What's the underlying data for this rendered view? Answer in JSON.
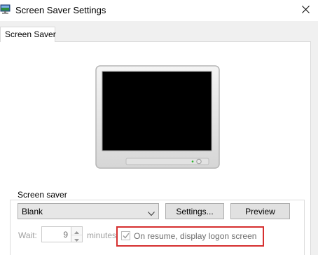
{
  "window": {
    "title": "Screen Saver Settings",
    "app_icon": "monitor-icon",
    "close_icon": "close-icon"
  },
  "tabs": [
    {
      "label": "Screen Saver",
      "selected": true
    }
  ],
  "preview": {
    "image": "monitor-preview-illustration"
  },
  "screen_saver_group": {
    "label": "Screen saver",
    "selected_value": "Blank",
    "settings_button": "Settings...",
    "preview_button": "Preview"
  },
  "wait": {
    "label": "Wait:",
    "value": "9",
    "unit_label": "minutes",
    "enabled": false
  },
  "logon_option": {
    "label": "On resume, display logon screen",
    "checked": true,
    "enabled": false
  },
  "colors": {
    "highlight_border": "#d62f2f",
    "panel_background": "#ffffff",
    "dialog_background": "#f0f0f0"
  }
}
